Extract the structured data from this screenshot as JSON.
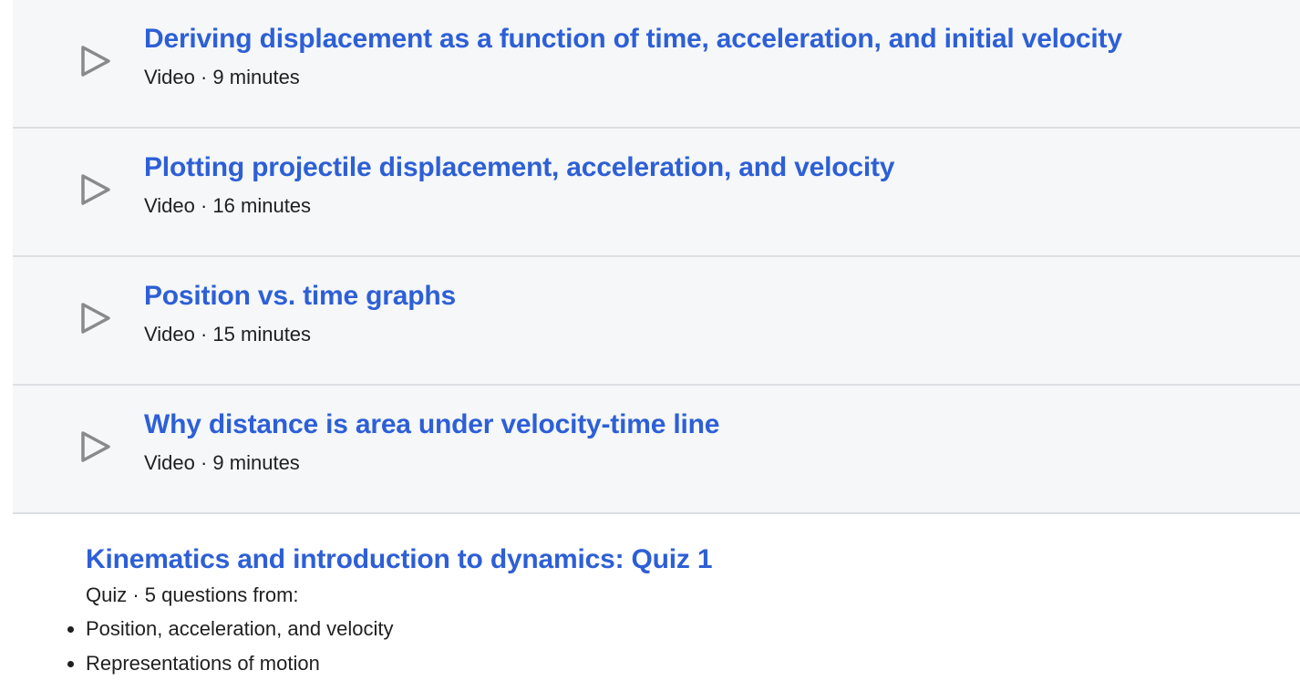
{
  "videos": [
    {
      "title": "Deriving displacement as a function of time, acceleration, and initial velocity",
      "meta": "Video · 9 minutes",
      "icon": "play-icon"
    },
    {
      "title": "Plotting projectile displacement, acceleration, and velocity",
      "meta": "Video · 16 minutes",
      "icon": "play-icon"
    },
    {
      "title": "Position vs. time graphs",
      "meta": "Video · 15 minutes",
      "icon": "play-icon"
    },
    {
      "title": "Why distance is area under velocity-time line",
      "meta": "Video · 9 minutes",
      "icon": "play-icon"
    }
  ],
  "quiz": {
    "title": "Kinematics and introduction to dynamics: Quiz 1",
    "meta": "Quiz · 5 questions from:",
    "topics": [
      "Position, acceleration, and velocity",
      "Representations of motion"
    ]
  },
  "colors": {
    "link": "#2d5fd6",
    "row_background": "#f5f7f8",
    "divider": "#dcdfe3",
    "icon": "#8a8a8a"
  }
}
